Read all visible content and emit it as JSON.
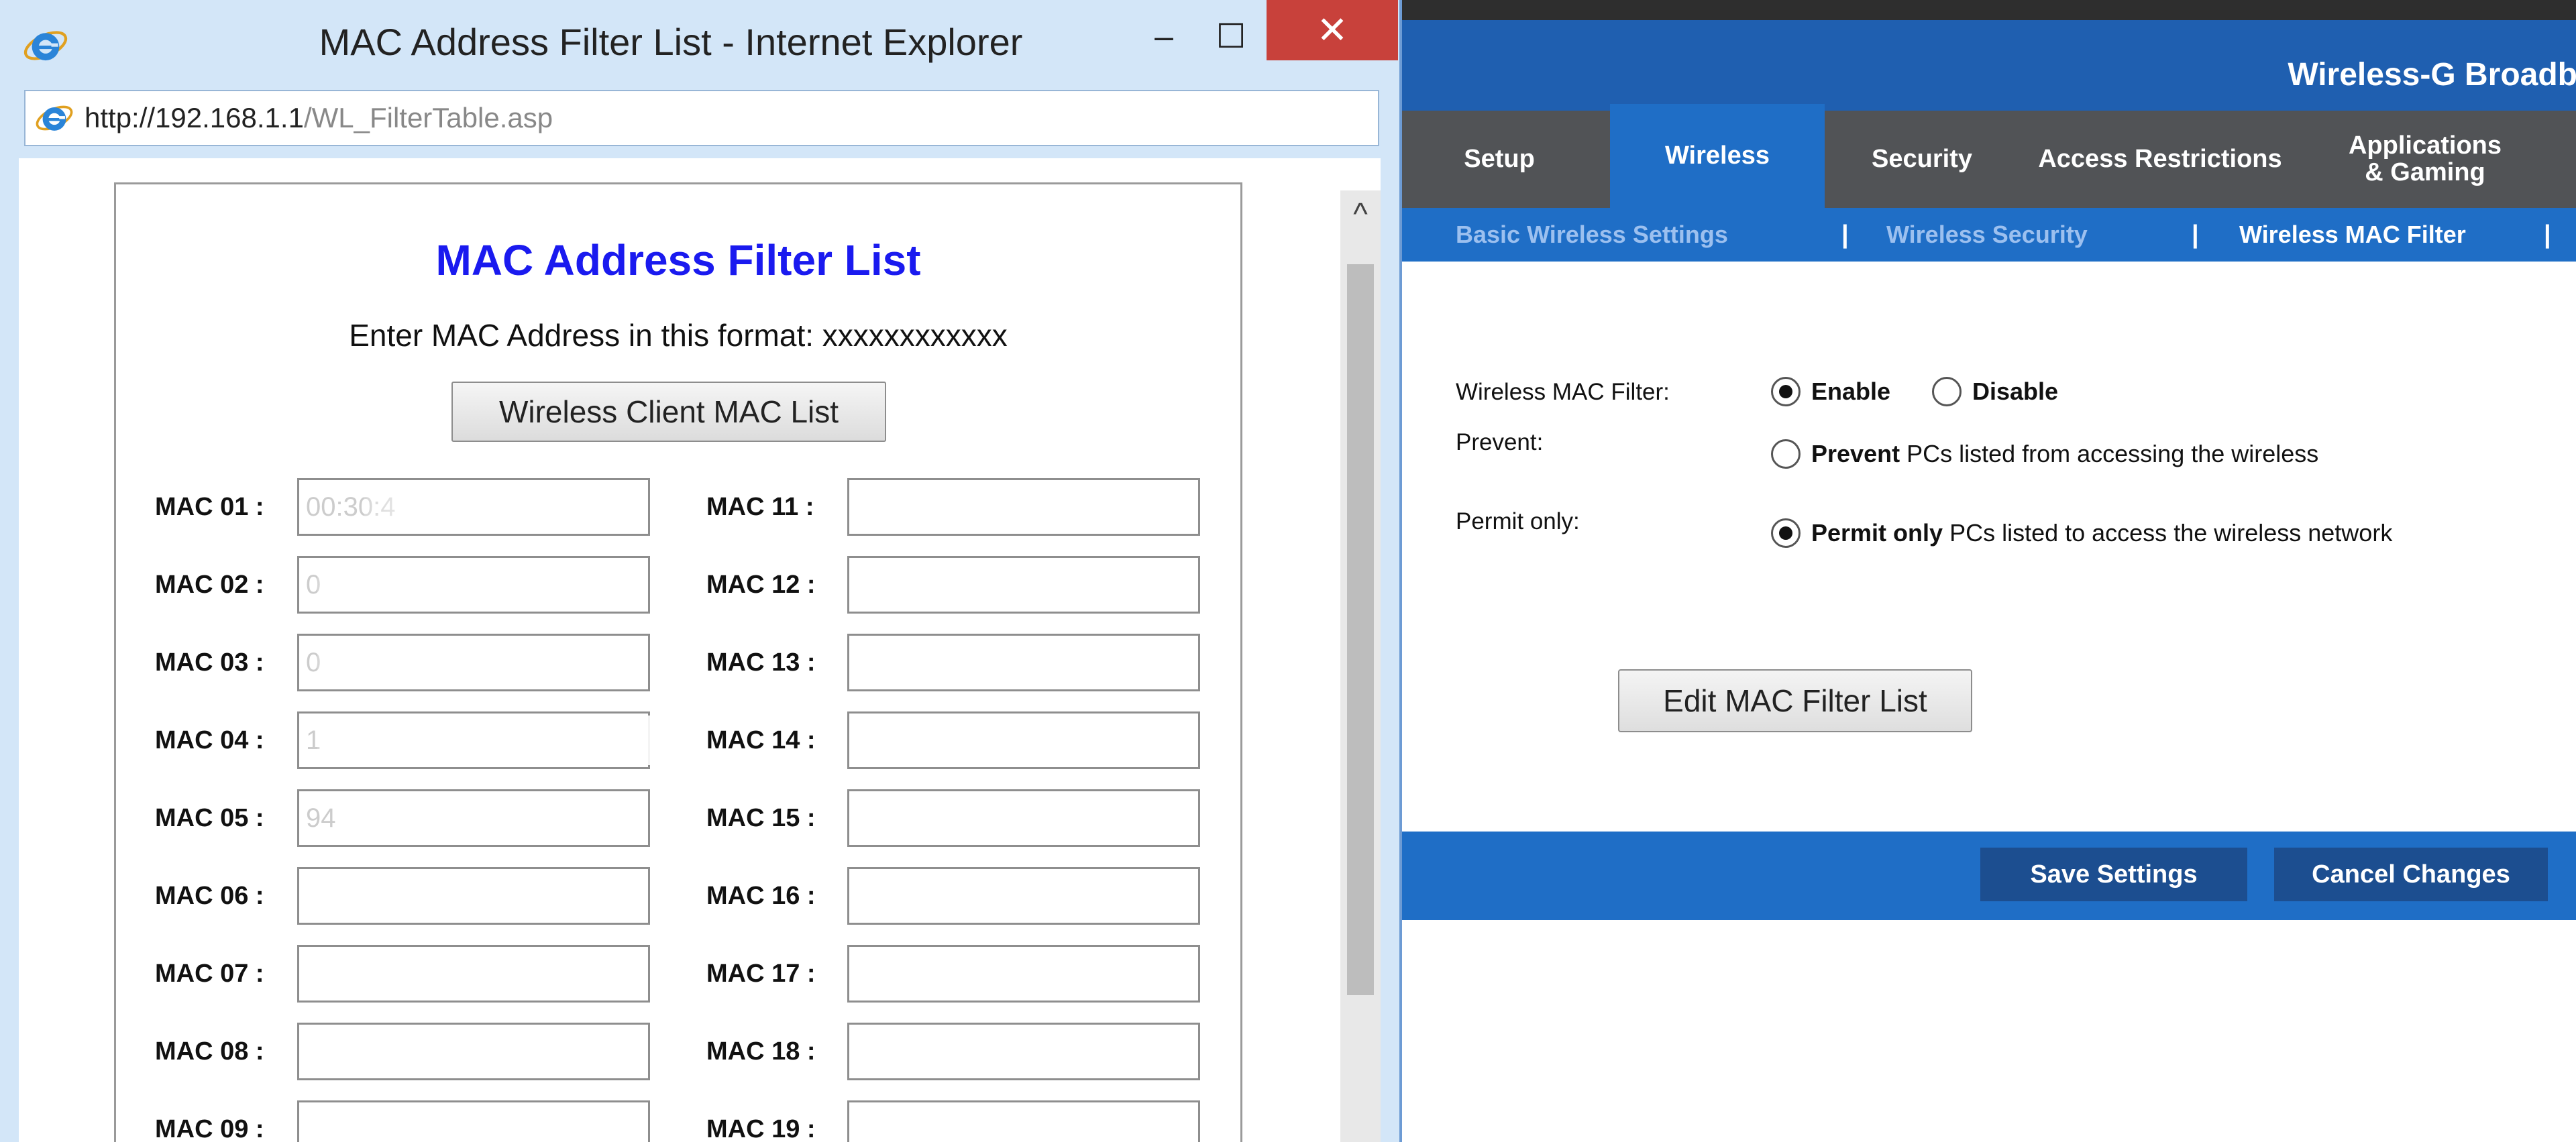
{
  "ie_window": {
    "title": "MAC Address Filter List - Internet Explorer",
    "minimize_glyph": "–",
    "maximize_glyph": "☐",
    "close_glyph": "✕",
    "address": {
      "host": "http://192.168.1.1",
      "path": "/WL_FilterTable.asp"
    }
  },
  "filter_page": {
    "title": "MAC Address Filter List",
    "instruction": "Enter MAC Address in this format: xxxxxxxxxxxx",
    "client_list_button": "Wireless Client MAC List",
    "left_column": [
      {
        "label": "MAC 01 :",
        "value": "00:30:4"
      },
      {
        "label": "MAC 02 :",
        "value": "0"
      },
      {
        "label": "MAC 03 :",
        "value": "0"
      },
      {
        "label": "MAC 04 :",
        "value": "1"
      },
      {
        "label": "MAC 05 :",
        "value": "94"
      },
      {
        "label": "MAC 06 :",
        "value": ""
      },
      {
        "label": "MAC 07 :",
        "value": ""
      },
      {
        "label": "MAC 08 :",
        "value": ""
      },
      {
        "label": "MAC 09 :",
        "value": ""
      }
    ],
    "right_column": [
      {
        "label": "MAC 11 :",
        "value": ""
      },
      {
        "label": "MAC 12 :",
        "value": ""
      },
      {
        "label": "MAC 13 :",
        "value": ""
      },
      {
        "label": "MAC 14 :",
        "value": ""
      },
      {
        "label": "MAC 15 :",
        "value": ""
      },
      {
        "label": "MAC 16 :",
        "value": ""
      },
      {
        "label": "MAC 17 :",
        "value": ""
      },
      {
        "label": "MAC 18 :",
        "value": ""
      },
      {
        "label": "MAC 19 :",
        "value": ""
      }
    ],
    "scroll_up_glyph": "^"
  },
  "router": {
    "product_name": "Wireless-G Broadb",
    "tabs": {
      "setup": "Setup",
      "wireless": "Wireless",
      "security": "Security",
      "access": "Access Restrictions",
      "apps_line1": "Applications",
      "apps_line2": "& Gaming"
    },
    "subnav": {
      "basic": "Basic Wireless Settings",
      "security": "Wireless Security",
      "mac_filter": "Wireless MAC Filter",
      "separator": "|"
    },
    "form": {
      "mac_filter_label": "Wireless MAC Filter:",
      "enable": "Enable",
      "disable": "Disable",
      "prevent_label": "Prevent:",
      "prevent_bold": "Prevent",
      "prevent_rest": "PCs listed from accessing the wireless",
      "permit_label": "Permit only:",
      "permit_bold": "Permit only",
      "permit_rest": "PCs listed to access the wireless network",
      "edit_button": "Edit MAC Filter List"
    },
    "footer": {
      "save": "Save Settings",
      "cancel": "Cancel Changes"
    }
  },
  "colors": {
    "ie_frame": "#d3e6f8",
    "close_red": "#c8413b",
    "filter_title_blue": "#1a1aef",
    "router_blue": "#1f6ec6",
    "router_dark_blue": "#1c4e90",
    "nav_gray": "#515356"
  }
}
